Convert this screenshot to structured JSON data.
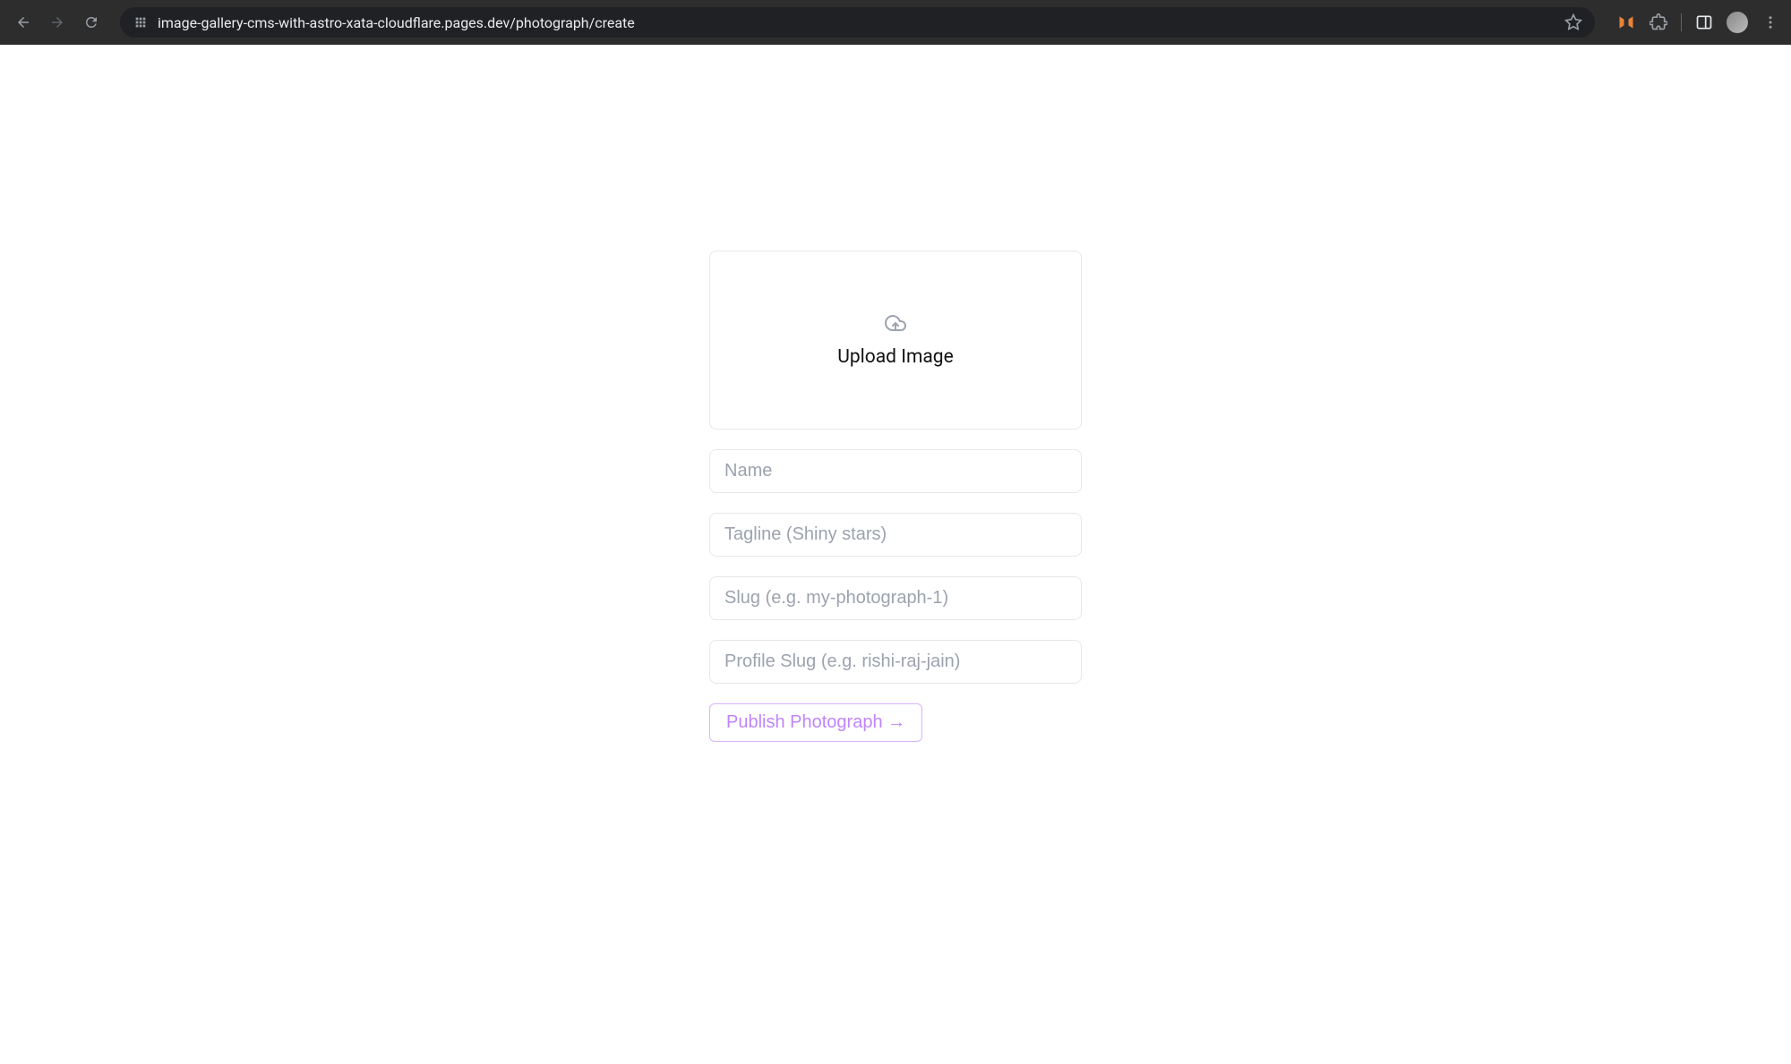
{
  "browser": {
    "url": "image-gallery-cms-with-astro-xata-cloudflare.pages.dev/photograph/create"
  },
  "form": {
    "upload_label": "Upload Image",
    "name_placeholder": "Name",
    "tagline_placeholder": "Tagline (Shiny stars)",
    "slug_placeholder": "Slug (e.g. my-photograph-1)",
    "profile_slug_placeholder": "Profile Slug (e.g. rishi-raj-jain)",
    "publish_label": "Publish Photograph →"
  }
}
